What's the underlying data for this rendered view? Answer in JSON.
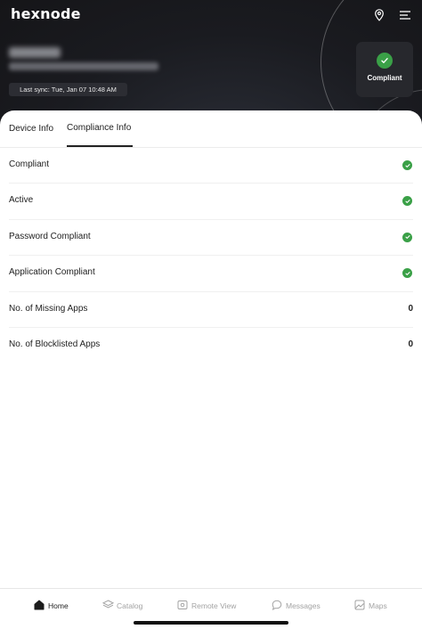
{
  "header": {
    "logo": "hexnode",
    "icons": {
      "location": "location-pin-icon",
      "menu": "menu-icon"
    },
    "sync_text": "Last sync: Tue, Jan 07 10:48 AM",
    "status_card": {
      "label": "Compliant",
      "icon": "check-circle-icon",
      "color": "#3aa047"
    }
  },
  "tabs": [
    {
      "label": "Device Info",
      "active": false
    },
    {
      "label": "Compliance Info",
      "active": true
    }
  ],
  "rows": [
    {
      "label": "Compliant",
      "type": "check"
    },
    {
      "label": "Active",
      "type": "check"
    },
    {
      "label": "Password Compliant",
      "type": "check"
    },
    {
      "label": "Application Compliant",
      "type": "check"
    },
    {
      "label": "No. of Missing Apps",
      "type": "value",
      "value": "0"
    },
    {
      "label": "No. of Blocklisted Apps",
      "type": "value",
      "value": "0"
    }
  ],
  "bottom_nav": [
    {
      "label": "Home",
      "icon": "home-icon",
      "active": true
    },
    {
      "label": "Catalog",
      "icon": "catalog-icon",
      "active": false
    },
    {
      "label": "Remote View",
      "icon": "remote-view-icon",
      "active": false
    },
    {
      "label": "Messages",
      "icon": "messages-icon",
      "active": false
    },
    {
      "label": "Maps",
      "icon": "maps-icon",
      "active": false
    }
  ],
  "colors": {
    "check_green": "#3aa047",
    "hero_bg": "#1a1b20"
  }
}
